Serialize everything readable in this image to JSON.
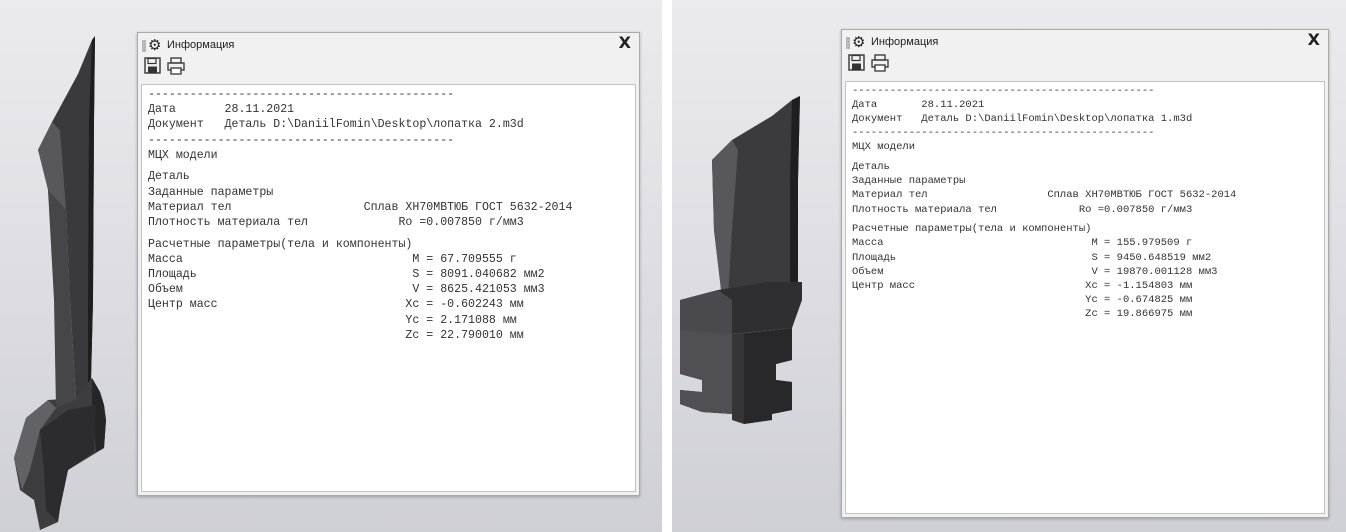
{
  "windows": [
    {
      "title": "Информация",
      "close_label": "X",
      "toolbar": [
        "save-icon",
        "print-icon"
      ],
      "report": [
        "--------------------------------------------",
        "Дата       28.11.2021",
        "Документ   Деталь D:\\DaniilFomin\\Desktop\\лопатка 2.m3d",
        "--------------------------------------------",
        "МЦХ модели",
        "",
        "Деталь",
        "Заданные параметры",
        "Материал тел                   Сплав ХН70МВТЮБ ГОСТ 5632-2014",
        "Плотность материала тел             Ro =0.007850 г/мм3",
        "",
        "Расчетные параметры(тела и компоненты)",
        "Масса                                 M = 67.709555 г",
        "Площадь                               S = 8091.040682 мм2",
        "Объем                                 V = 8625.421053 мм3",
        "Центр масс                           Xc = -0.602243 мм",
        "                                     Yc = 2.171088 мм",
        "                                     Zc = 22.790010 мм"
      ]
    },
    {
      "title": "Информация",
      "close_label": "X",
      "toolbar": [
        "save-icon",
        "print-icon"
      ],
      "report": [
        "------------------------------------------------",
        "Дата       28.11.2021",
        "Документ   Деталь D:\\DaniilFomin\\Desktop\\лопатка 1.m3d",
        "------------------------------------------------",
        "МЦХ модели",
        "",
        "Деталь",
        "Заданные параметры",
        "Материал тел                   Сплав ХН70МВТЮБ ГОСТ 5632-2014",
        "Плотность материала тел             Ro =0.007850 г/мм3",
        "",
        "Расчетные параметры(тела и компоненты)",
        "Масса                                 M = 155.979509 г",
        "Площадь                               S = 9450.648519 мм2",
        "Объем                                 V = 19870.001128 мм3",
        "Центр масс                           Xc = -1.154803 мм",
        "                                     Yc = -0.674825 мм",
        "                                     Zc = 19.866975 мм"
      ]
    }
  ]
}
